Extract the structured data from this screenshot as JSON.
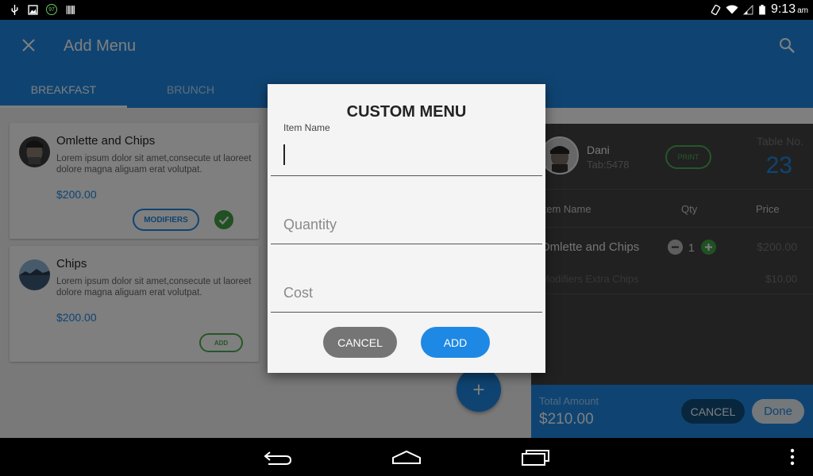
{
  "status_bar": {
    "battery_level": "97",
    "time": "9:13",
    "ampm": "am"
  },
  "app_bar": {
    "title": "Add Menu",
    "close_icon": "close-icon",
    "search_icon": "search-icon",
    "tabs": [
      {
        "label": "BREAKFAST",
        "active": true
      },
      {
        "label": "BRUNCH",
        "active": false
      }
    ]
  },
  "menu_items": [
    {
      "name": "Omlette and Chips",
      "description": "Lorem ipsum dolor sit amet,consecute ut laoreet dolore magna aliguam erat volutpat.",
      "price": "$200.00",
      "action_label": "MODIFIERS",
      "selected": true
    },
    {
      "name": "Chips",
      "description": "Lorem ipsum dolor sit amet,consecute ut laoreet dolore magna aliguam erat volutpat.",
      "price": "$200.00",
      "action_label": "ADD",
      "selected": false
    }
  ],
  "fab": {
    "label": "+"
  },
  "order": {
    "customer_name": "Dani",
    "customer_tab": "Tab:5478",
    "print_label": "PRINT",
    "table_label": "Table No.",
    "table_number": "23",
    "columns": {
      "item": "Item Name",
      "qty": "Qty",
      "price": "Price"
    },
    "item": {
      "name": "Omlette and Chips",
      "qty": "1",
      "price": "$200.00"
    },
    "modifier": {
      "name": "Modifiers Extra Chips",
      "price": "$10.00"
    },
    "total_label": "Total Amount",
    "total_amount": "$210.00",
    "cancel_label": "CANCEL",
    "done_label": "Done"
  },
  "dialog": {
    "title": "CUSTOM MENU",
    "item_name_label": "Item Name",
    "item_name_value": "",
    "quantity_placeholder": "Quantity",
    "cost_placeholder": "Cost",
    "cancel_label": "CANCEL",
    "add_label": "ADD"
  },
  "colors": {
    "primary": "#1e88e5",
    "accent_green": "#43a047",
    "panel_dark": "#424242"
  }
}
